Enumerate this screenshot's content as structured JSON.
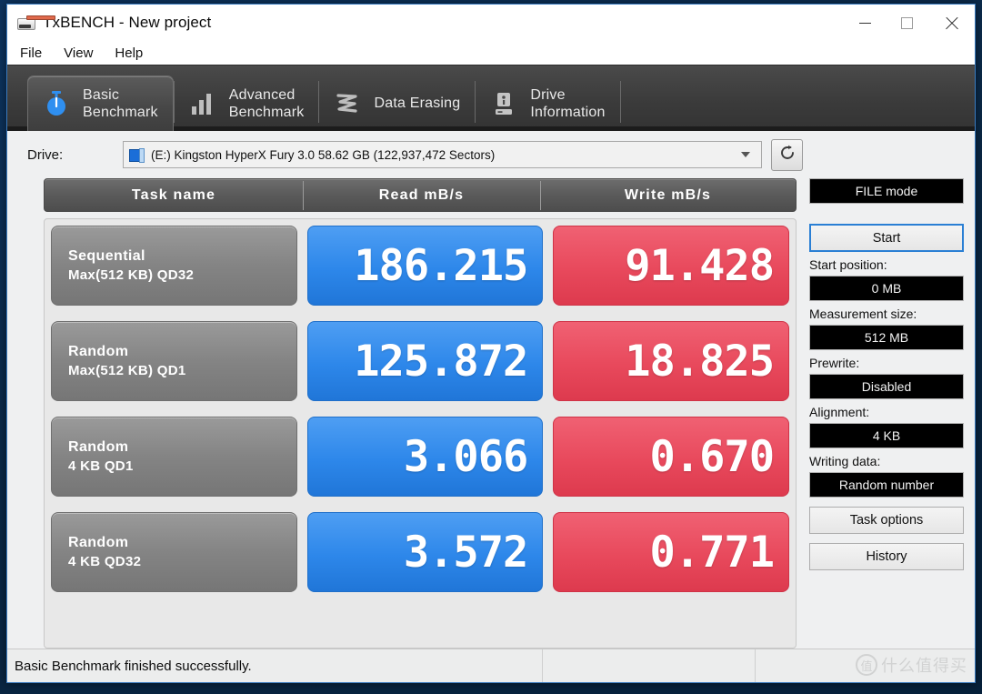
{
  "window": {
    "title": "TxBENCH - New project",
    "icon": "app-icon",
    "minimize_label": "Minimize",
    "maximize_label": "Maximize",
    "close_label": "Close"
  },
  "menubar": {
    "items": [
      {
        "label": "File"
      },
      {
        "label": "View"
      },
      {
        "label": "Help"
      }
    ]
  },
  "tabs": [
    {
      "label": "Basic\nBenchmark",
      "icon": "stopwatch-icon",
      "active": true
    },
    {
      "label": "Advanced\nBenchmark",
      "icon": "bar-chart-icon",
      "active": false
    },
    {
      "label": "Data Erasing",
      "icon": "scribble-erase-icon",
      "active": false
    },
    {
      "label": "Drive\nInformation",
      "icon": "drive-info-icon",
      "active": false
    }
  ],
  "drive": {
    "label": "Drive:",
    "selected": "(E:) Kingston HyperX Fury 3.0  58.62 GB (122,937,472 Sectors)",
    "icon": "disk-drive-icon",
    "refresh_icon": "refresh-icon"
  },
  "table": {
    "headers": {
      "name": "Task name",
      "read": "Read mB/s",
      "write": "Write mB/s"
    },
    "rows": [
      {
        "name_line1": "Sequential",
        "name_line2": "Max(512 KB) QD32",
        "read": "186.215",
        "write": "91.428"
      },
      {
        "name_line1": "Random",
        "name_line2": "Max(512 KB) QD1",
        "read": "125.872",
        "write": "18.825"
      },
      {
        "name_line1": "Random",
        "name_line2": "4 KB QD1",
        "read": "3.066",
        "write": "0.670"
      },
      {
        "name_line1": "Random",
        "name_line2": "4 KB QD32",
        "read": "3.572",
        "write": "0.771"
      }
    ]
  },
  "sidebar": {
    "mode_button": "FILE mode",
    "start_button": "Start",
    "start_position_label": "Start position:",
    "start_position_value": "0 MB",
    "measurement_size_label": "Measurement size:",
    "measurement_size_value": "512 MB",
    "prewrite_label": "Prewrite:",
    "prewrite_value": "Disabled",
    "alignment_label": "Alignment:",
    "alignment_value": "4 KB",
    "writing_data_label": "Writing data:",
    "writing_data_value": "Random number",
    "task_options_button": "Task options",
    "history_button": "History"
  },
  "statusbar": {
    "message": "Basic Benchmark finished successfully.",
    "cell2": "",
    "cell3": "",
    "watermark_badge": "值",
    "watermark_text": "什么值得买"
  },
  "colors": {
    "read_blue": "#2d87ea",
    "write_red": "#e8495c",
    "tab_active": "#4a4a4a",
    "accent": "#2a7fd4"
  }
}
